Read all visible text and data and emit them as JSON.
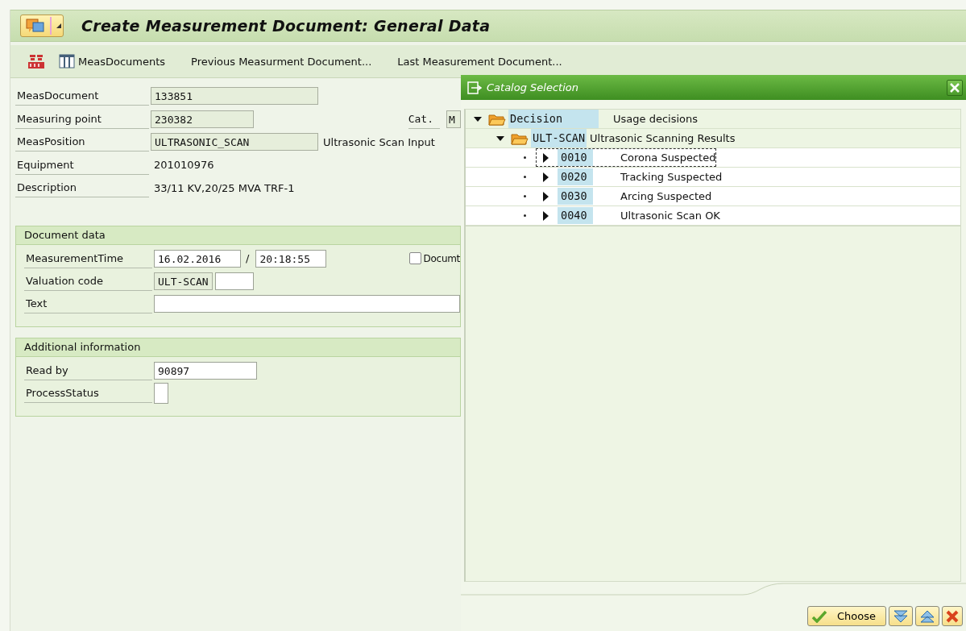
{
  "window": {
    "title": "Create Measurement Document: General Data"
  },
  "toolbar": [
    {
      "kind": "money"
    },
    {
      "kind": "table",
      "label": "MeasDocuments"
    },
    {
      "kind": "text",
      "label": "Previous Measurment Document..."
    },
    {
      "kind": "text",
      "label": "Last Measurement Document..."
    }
  ],
  "header_fields": [
    {
      "label": "MeasDocument",
      "value": "133851",
      "kind": "long"
    },
    {
      "label": "Measuring point",
      "value": "230382",
      "kind": "short",
      "cat": {
        "label": "Cat.",
        "value": "M"
      }
    },
    {
      "label": "MeasPosition",
      "value": "ULTRASONIC_SCAN",
      "kind": "long",
      "note": "Ultrasonic Scan Input"
    },
    {
      "label": "Equipment",
      "value": "201010976",
      "kind": "text"
    },
    {
      "label": "Description",
      "value": "33/11 KV,20/25 MVA TRF-1",
      "kind": "text"
    }
  ],
  "groups": [
    {
      "title": "Document data",
      "rows": [
        {
          "kind": "datetime",
          "label": "MeasurementTime",
          "date": "16.02.2016",
          "separator": "/",
          "time": "20:18:55",
          "checkbox": {
            "label": "Documt",
            "checked": false
          }
        },
        {
          "kind": "code",
          "label": "Valuation code",
          "value": "ULT-SCAN"
        },
        {
          "kind": "wide",
          "label": "Text"
        }
      ]
    },
    {
      "title": "Additional information",
      "rows": [
        {
          "kind": "input",
          "label": "Read by",
          "value": "90897"
        },
        {
          "kind": "small",
          "label": "ProcessStatus"
        }
      ]
    }
  ],
  "dialog": {
    "title": "Catalog Selection",
    "tree": [
      {
        "key": "Decision",
        "text": "Usage decisions",
        "expanded": true,
        "children": [
          {
            "key": "ULT-SCAN",
            "text": "Ultrasonic Scanning Results",
            "expanded": true,
            "children": [
              {
                "key": "0010",
                "text": "Corona Suspected",
                "selected": true
              },
              {
                "key": "0020",
                "text": "Tracking Suspected",
                "selected": false
              },
              {
                "key": "0030",
                "text": "Arcing Suspected",
                "selected": false
              },
              {
                "key": "0040",
                "text": "Ultrasonic Scan OK",
                "selected": false
              }
            ]
          }
        ]
      }
    ],
    "buttons": [
      {
        "kind": "choose",
        "label": "Choose"
      },
      {
        "kind": "down"
      },
      {
        "kind": "up"
      },
      {
        "kind": "cancel"
      }
    ]
  }
}
